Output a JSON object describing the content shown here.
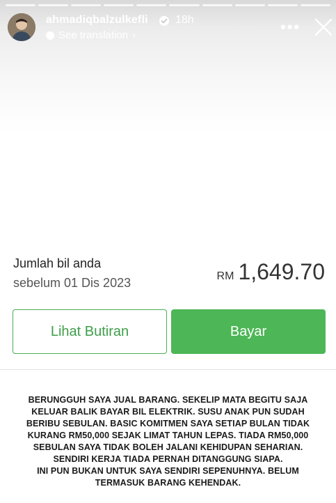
{
  "story": {
    "username": "ahmadiqbalzulkefli",
    "time": "18h",
    "translation_label": "See translation",
    "translation_chevron": "›",
    "more_label": "•••"
  },
  "bill": {
    "label": "Jumlah bil anda",
    "due_date": "sebelum 01 Dis 2023",
    "currency": "RM",
    "amount": "1,649.70"
  },
  "buttons": {
    "details_label": "Lihat Butiran",
    "pay_label": "Bayar"
  },
  "caption": {
    "lines": [
      "BERUNGGUH SAYA JUAL BARANG. SEKELIP MATA BEGITU SAJA",
      "KELUAR BALIK BAYAR BIL ELEKTRIK. SUSU ANAK PUN SUDAH",
      "BERIBU SEBULAN. BASIC KOMITMEN SAYA SETIAP BULAN TIDAK",
      "KURANG RM50,000 SEJAK LIMAT TAHUN LEPAS. TIADA RM50,000",
      "SEBULAN SAYA TIDAK BOLEH JALANI KEHIDUPAN SEHARIAN.",
      "SENDIRI KERJA TIADA PERNAH DITANGGUNG SIAPA.",
      "INI PUN BUKAN UNTUK SAYA SENDIRI SEPENUHNYA. BELUM",
      "TERMASUK BARANG KEHENDAK."
    ]
  },
  "colors": {
    "accent_green": "#4db656",
    "outline_green": "#4cae56"
  },
  "icons": {
    "verified": "verified-badge-icon",
    "close": "close-icon",
    "more": "more-options-icon"
  }
}
